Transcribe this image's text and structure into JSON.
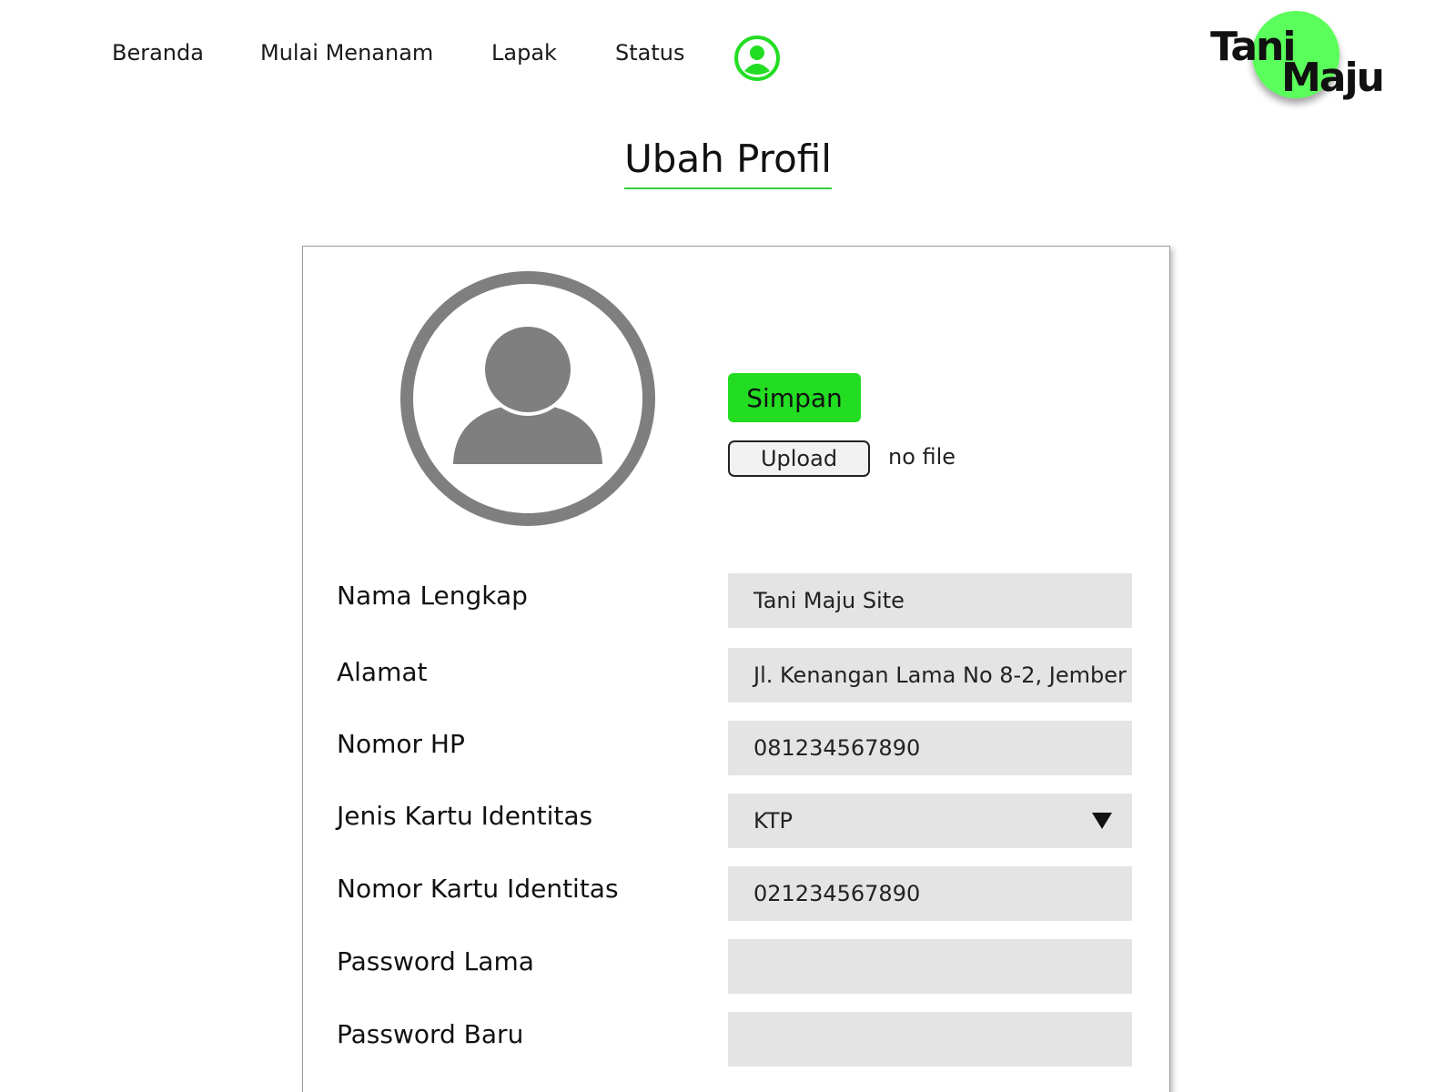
{
  "nav": {
    "items": [
      {
        "label": "Beranda"
      },
      {
        "label": "Mulai Menanam"
      },
      {
        "label": "Lapak"
      },
      {
        "label": "Status"
      }
    ],
    "profile_icon": "user-circle-icon"
  },
  "logo": {
    "word1": "Tani",
    "word2": "Maju"
  },
  "page": {
    "title": "Ubah Profil"
  },
  "profile": {
    "avatar_icon": "user-avatar-icon",
    "save_label": "Simpan",
    "upload_label": "Upload",
    "file_status": "no file"
  },
  "form": {
    "fields": [
      {
        "label": "Nama Lengkap",
        "value": "Tani Maju Site"
      },
      {
        "label": "Alamat",
        "value": "Jl. Kenangan Lama No 8-2, Jember"
      },
      {
        "label": "Nomor HP",
        "value": "081234567890"
      },
      {
        "label": "Jenis Kartu Identitas",
        "value": "KTP"
      },
      {
        "label": "Nomor Kartu Identitas",
        "value": "021234567890"
      },
      {
        "label": "Password Lama",
        "value": ""
      },
      {
        "label": "Password Baru",
        "value": ""
      }
    ]
  },
  "colors": {
    "accent": "#22dd22",
    "logo_green": "#5bff5b",
    "input_bg": "#e5e4e4",
    "icon_gray": "#7f7f7f"
  }
}
